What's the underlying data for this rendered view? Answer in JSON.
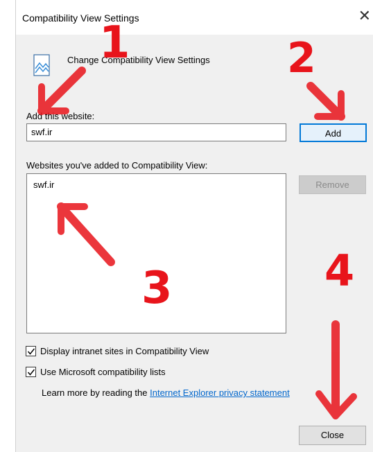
{
  "window": {
    "title": "Compatibility View Settings",
    "close_glyph": "✕"
  },
  "header": {
    "text": "Change Compatibility View Settings",
    "icon": "compatibility-view-icon"
  },
  "add_section": {
    "label": "Add this website:",
    "input_value": "swf.ir",
    "add_button": "Add"
  },
  "list_section": {
    "label": "Websites you've added to Compatibility View:",
    "items": [
      "swf.ir"
    ],
    "remove_button": "Remove"
  },
  "options": {
    "intranet": {
      "label": "Display intranet sites in Compatibility View",
      "checked": true
    },
    "ms_lists": {
      "label": "Use Microsoft compatibility lists",
      "checked": true
    }
  },
  "learn_more": {
    "prefix": "Learn more by reading the ",
    "link_text": "Internet Explorer privacy statement"
  },
  "footer": {
    "close_button": "Close"
  },
  "annotations": {
    "step1": "1",
    "step2": "2",
    "step3": "3",
    "step4": "4",
    "color": "#e8141b"
  }
}
